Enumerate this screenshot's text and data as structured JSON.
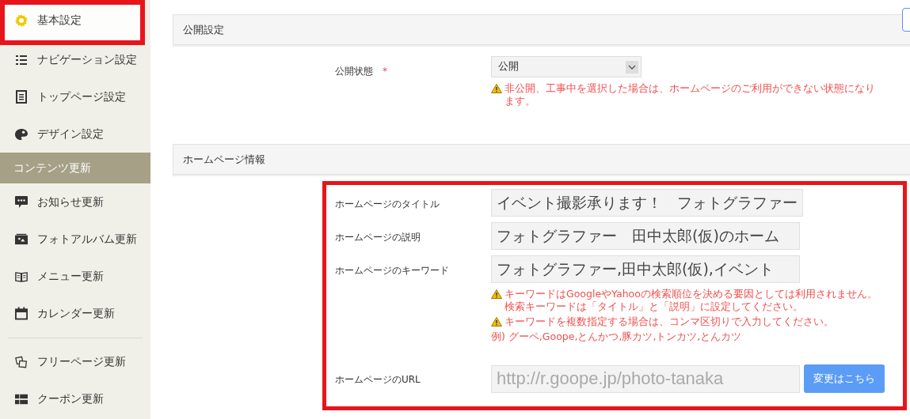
{
  "sidebar": {
    "items": [
      {
        "kind": "item",
        "label": "基本設定",
        "selected": true,
        "highlighted": true
      },
      {
        "kind": "item",
        "label": "ナビゲーション設定",
        "selected": false,
        "highlighted": false
      },
      {
        "kind": "item",
        "label": "トップページ設定",
        "selected": false,
        "highlighted": false
      },
      {
        "kind": "item",
        "label": "デザイン設定",
        "selected": false,
        "highlighted": false
      },
      {
        "kind": "header",
        "label": "コンテンツ更新"
      },
      {
        "kind": "item",
        "label": "お知らせ更新",
        "selected": false,
        "highlighted": false
      },
      {
        "kind": "item",
        "label": "フォトアルバム更新",
        "selected": false,
        "highlighted": false
      },
      {
        "kind": "item",
        "label": "メニュー更新",
        "selected": false,
        "highlighted": false
      },
      {
        "kind": "item",
        "label": "カレンダー更新",
        "selected": false,
        "highlighted": false
      },
      {
        "kind": "divider"
      },
      {
        "kind": "item",
        "label": "フリーページ更新",
        "selected": false,
        "highlighted": false
      },
      {
        "kind": "item",
        "label": "クーポン更新",
        "selected": false,
        "highlighted": false
      }
    ]
  },
  "sections": [
    {
      "title": "公開設定",
      "highlighted": false,
      "rows": [
        {
          "kind": "select",
          "label": "公開状態",
          "required_mark": "*",
          "value": "公開",
          "notes": [
            {
              "kind": "warning",
              "text": "非公開、工事中を選択した場合は、ホームページのご利用ができない状態になります。"
            }
          ]
        }
      ]
    },
    {
      "title": "ホームページ情報",
      "highlighted": true,
      "rows": [
        {
          "kind": "text",
          "label": "ホームページのタイトル",
          "value": "イベント撮影承ります！　フォトグラファー"
        },
        {
          "kind": "text",
          "label": "ホームページの説明",
          "value": "フォトグラファー　田中太郎(仮)のホーム"
        },
        {
          "kind": "text",
          "label": "ホームページのキーワード",
          "value": "フォトグラファー,田中太郎(仮),イベント",
          "notes": [
            {
              "kind": "warning",
              "text": "キーワードはGoogleやYahooの検索順位を決める要因としては利用されません。検索キーワードは「タイトル」と「説明」に設定してください。"
            },
            {
              "kind": "warning",
              "text": "キーワードを複数指定する場合は、コンマ区切りで入力してください。"
            },
            {
              "kind": "plain",
              "text": "例) グーペ,Goope,とんかつ,豚カツ,トンカツ,とんカツ"
            }
          ]
        },
        {
          "kind": "url",
          "label": "ホームページのURL",
          "value": "http://r.goope.jp/photo-tanaka",
          "disabled": true,
          "button": "変更はこちら"
        }
      ]
    }
  ]
}
